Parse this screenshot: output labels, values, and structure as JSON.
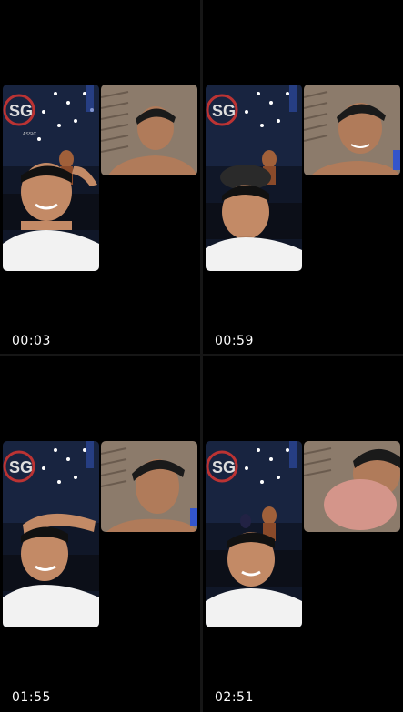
{
  "timestamps": [
    "00:03",
    "00:59",
    "01:55",
    "02:51"
  ],
  "stage_logo_text": "ASSIC",
  "colors": {
    "background": "#000000",
    "stage_dark": "#141c2b",
    "stage_blue": "#2a3a6a",
    "shirt_white": "#f2f2f2",
    "skin": "#c98d68",
    "room_wall": "#8d7a68"
  }
}
